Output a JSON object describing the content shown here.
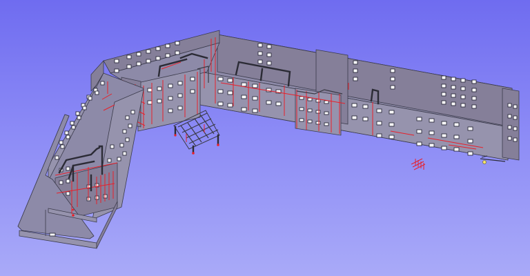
{
  "viewer": {
    "background_top": "#6f6cf0",
    "background_bottom": "#a9aaf8",
    "wall_color": "#9693ad",
    "edge_color": "#3a3a4a",
    "rebar_color": "#e8202a",
    "frame_color": "#2b2b35"
  },
  "model": {
    "type": "3d-building-model-wireframe",
    "icons": [
      "crosshair-cursor-icon"
    ]
  }
}
